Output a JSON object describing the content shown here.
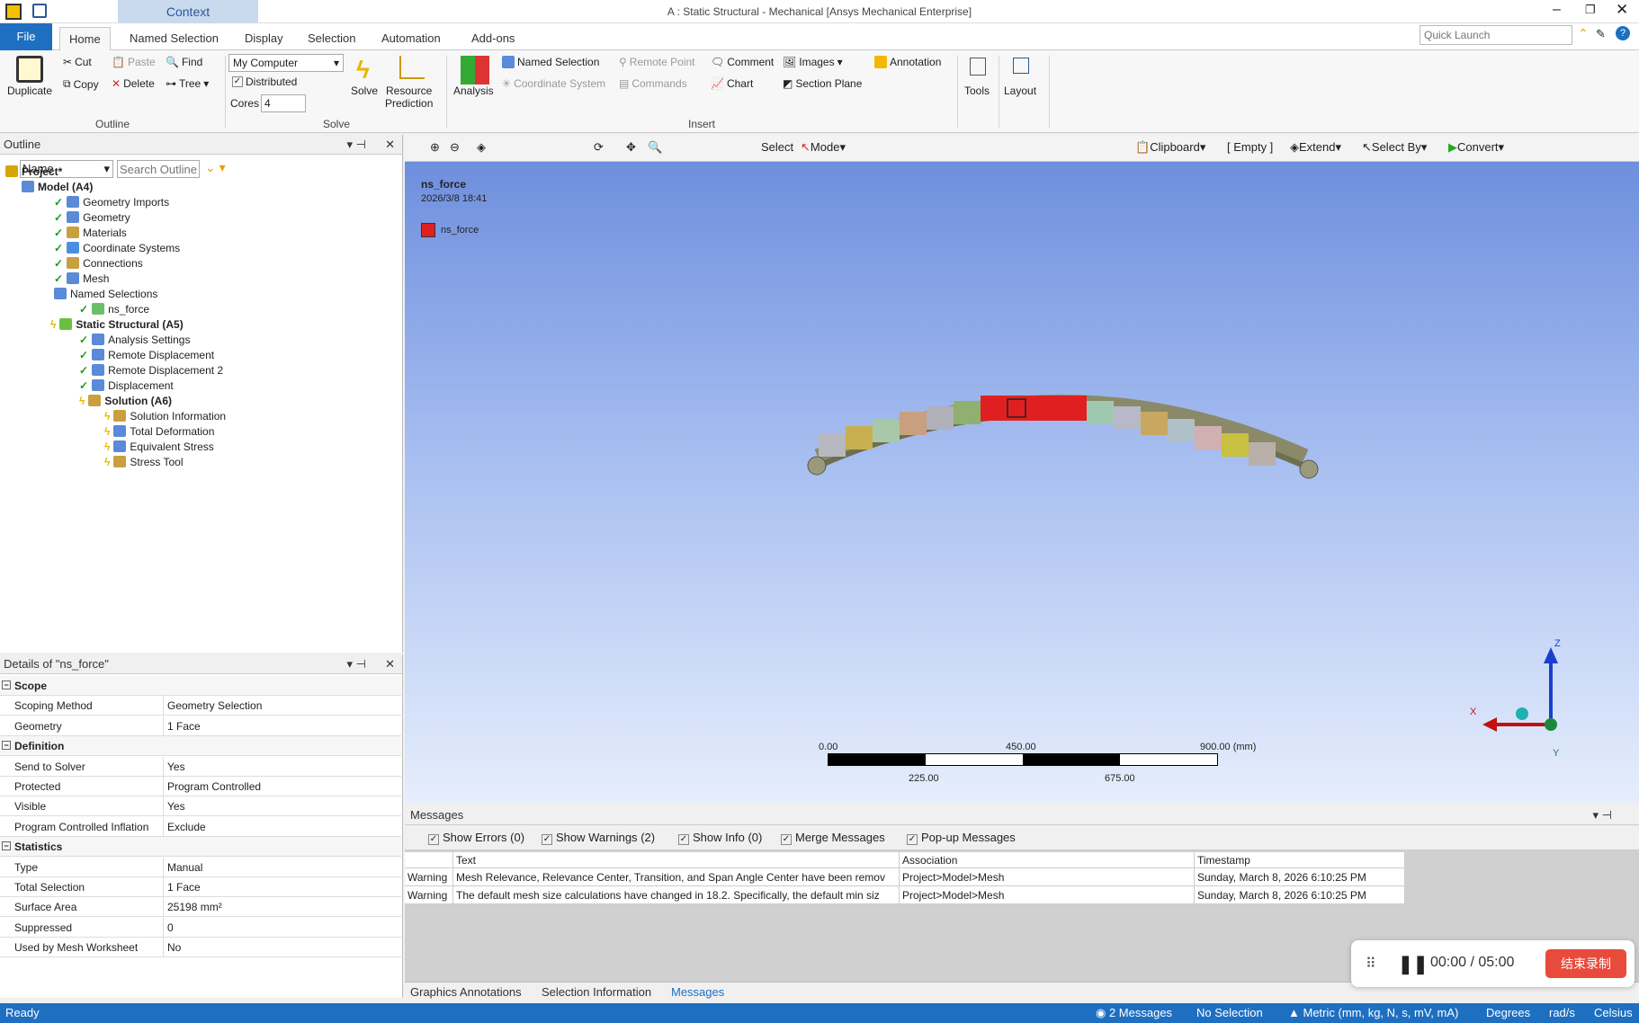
{
  "window": {
    "title": "A : Static Structural - Mechanical [Ansys Mechanical Enterprise]",
    "context_tab": "Context"
  },
  "tabs": [
    "File",
    "Home",
    "Named Selection",
    "Display",
    "Selection",
    "Automation",
    "Add-ons"
  ],
  "quick_launch": {
    "placeholder": "Quick Launch"
  },
  "ribbon": {
    "outline": {
      "duplicate": "Duplicate",
      "cut": "Cut",
      "copy": "Copy",
      "paste": "Paste",
      "delete": "Delete",
      "find": "Find",
      "tree": "Tree",
      "group": "Outline"
    },
    "solve": {
      "computer": "My Computer",
      "distributed": "Distributed",
      "cores_label": "Cores",
      "cores_value": "4",
      "solve": "Solve",
      "resource1": "Resource",
      "resource2": "Prediction",
      "group": "Solve"
    },
    "insert": {
      "analysis": "Analysis",
      "named_selection": "Named Selection",
      "remote_point": "Remote Point",
      "comment": "Comment",
      "images": "Images",
      "annotation": "Annotation",
      "coordinate_system": "Coordinate System",
      "commands": "Commands",
      "chart": "Chart",
      "section_plane": "Section Plane",
      "group": "Insert"
    },
    "tools": "Tools",
    "layout": "Layout"
  },
  "outline": {
    "title": "Outline",
    "name_filter": "Name",
    "search_placeholder": "Search Outline",
    "items": [
      {
        "label": "Project*"
      },
      {
        "label": "Model (A4)"
      },
      {
        "label": "Geometry Imports"
      },
      {
        "label": "Geometry"
      },
      {
        "label": "Materials"
      },
      {
        "label": "Coordinate Systems"
      },
      {
        "label": "Connections"
      },
      {
        "label": "Mesh"
      },
      {
        "label": "Named Selections"
      },
      {
        "label": "ns_force"
      },
      {
        "label": "Static Structural (A5)"
      },
      {
        "label": "Analysis Settings"
      },
      {
        "label": "Remote Displacement"
      },
      {
        "label": "Remote Displacement 2"
      },
      {
        "label": "Displacement"
      },
      {
        "label": "Solution (A6)"
      },
      {
        "label": "Solution Information"
      },
      {
        "label": "Total Deformation"
      },
      {
        "label": "Equivalent Stress"
      },
      {
        "label": "Stress Tool"
      }
    ]
  },
  "details": {
    "title": "Details of \"ns_force\"",
    "rows": [
      {
        "k": "Scope",
        "v": ""
      },
      {
        "k": "Scoping Method",
        "v": "Geometry Selection"
      },
      {
        "k": "Geometry",
        "v": "1 Face"
      },
      {
        "k": "Definition",
        "v": ""
      },
      {
        "k": "Send to Solver",
        "v": "Yes"
      },
      {
        "k": "Protected",
        "v": "Program Controlled"
      },
      {
        "k": "Visible",
        "v": "Yes"
      },
      {
        "k": "Program Controlled Inflation",
        "v": "Exclude"
      },
      {
        "k": "Statistics",
        "v": ""
      },
      {
        "k": "Type",
        "v": "Manual"
      },
      {
        "k": "Total Selection",
        "v": "1 Face"
      },
      {
        "k": "Surface Area",
        "v": "25198 mm²"
      },
      {
        "k": "Suppressed",
        "v": "0"
      },
      {
        "k": "Used by Mesh Worksheet",
        "v": "No"
      }
    ]
  },
  "graphics_toolbar": {
    "select": "Select",
    "mode": "Mode",
    "clipboard": "Clipboard",
    "empty": "[ Empty ]",
    "extend": "Extend",
    "select_by": "Select By",
    "convert": "Convert"
  },
  "viewport": {
    "label_title": "ns_force",
    "label_date": "2026/3/8 18:41",
    "legend_item": "ns_force",
    "legend_color": "#e02020",
    "scale": {
      "t0": "0.00",
      "t1": "450.00",
      "t2": "900.00 (mm)",
      "b1": "225.00",
      "b2": "675.00"
    },
    "axis": {
      "x": "X",
      "y": "Y",
      "z": "Z"
    }
  },
  "messages": {
    "title": "Messages",
    "filters": [
      {
        "label": "Show Errors",
        "count": "(0)"
      },
      {
        "label": "Show Warnings",
        "count": "(2)"
      },
      {
        "label": "Show Info",
        "count": "(0)"
      },
      {
        "label": "Merge Messages",
        "count": ""
      },
      {
        "label": "Pop-up Messages",
        "count": ""
      }
    ],
    "columns": [
      "Text",
      "Association",
      "Timestamp"
    ],
    "rows": [
      {
        "type": "Warning",
        "text": "Mesh Relevance, Relevance Center, Transition, and Span Angle Center have been remov",
        "assoc": "Project>Model>Mesh",
        "time": "Sunday, March 8, 2026 6:10:25 PM"
      },
      {
        "type": "Warning",
        "text": "The default mesh size calculations have changed in 18.2. Specifically, the default min siz",
        "assoc": "Project>Model>Mesh",
        "time": "Sunday, March 8, 2026 6:10:25 PM"
      }
    ]
  },
  "bottom_tabs": [
    "Graphics Annotations",
    "Selection Information",
    "Messages"
  ],
  "status": {
    "ready": "Ready",
    "messages": "2 Messages",
    "selection": "No Selection",
    "units": "Metric (mm, kg, N, s, mV, mA)",
    "angle": "Degrees",
    "rate": "rad/s",
    "temp": "Celsius"
  },
  "recorder": {
    "time": "00:00 / 05:00",
    "stop": "结束录制"
  }
}
